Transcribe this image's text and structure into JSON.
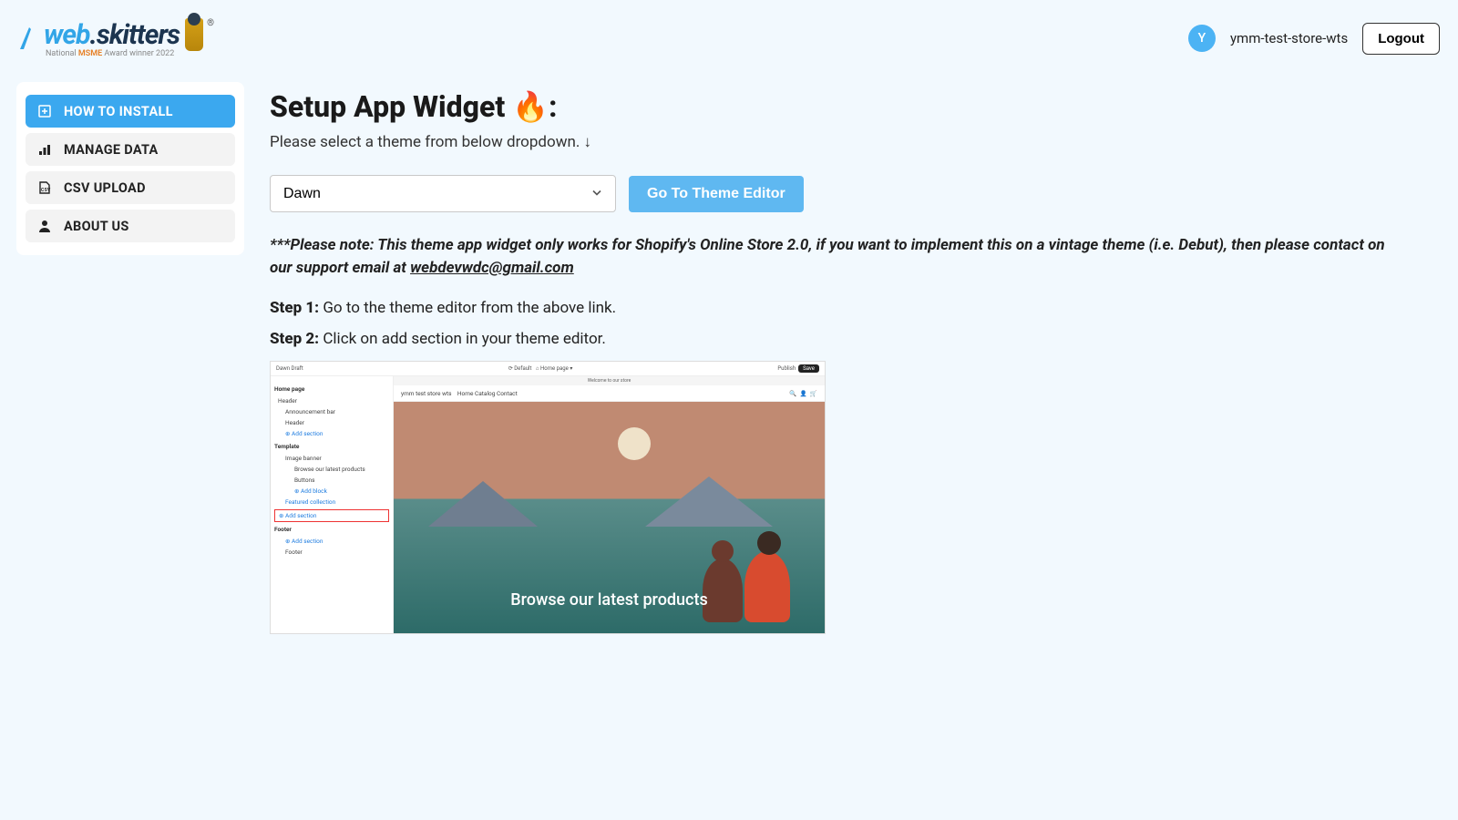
{
  "header": {
    "logo_primary": "web",
    "logo_secondary": "skitters",
    "logo_tagline_pre": "National ",
    "logo_tagline_em": "MSME",
    "logo_tagline_post": " Award winner 2022",
    "avatar_initial": "Y",
    "store_name": "ymm-test-store-wts",
    "logout": "Logout"
  },
  "sidebar": {
    "items": [
      {
        "label": "HOW TO INSTALL",
        "icon": "install"
      },
      {
        "label": "MANAGE DATA",
        "icon": "data"
      },
      {
        "label": "CSV UPLOAD",
        "icon": "csv"
      },
      {
        "label": "ABOUT US",
        "icon": "about"
      }
    ]
  },
  "main": {
    "title": "Setup App Widget 🔥:",
    "subtitle": "Please select a theme from below dropdown. ↓",
    "theme_selected": "Dawn",
    "go_button": "Go To Theme Editor",
    "note_prefix": "***Please note: This theme app widget only works for Shopify's Online Store 2.0, if you want to implement this on a vintage theme (i.e. Debut), then please contact on our support email at ",
    "note_email": "webdevwdc@gmail.com",
    "step1_label": "Step 1:",
    "step1_text": " Go to the theme editor from the above link.",
    "step2_label": "Step 2:",
    "step2_text": " Click on add section in your theme editor."
  },
  "shot": {
    "topbar_left": "Dawn   Draft",
    "topbar_mid1": "Default",
    "topbar_mid2": "Home page",
    "topbar_publish": "Publish",
    "topbar_save": "Save",
    "announce": "Welcome to our store",
    "store": "ymm test store wts",
    "nav": "Home    Catalog    Contact",
    "side_homepage": "Home page",
    "side_header": "Header",
    "side_announcement": "Announcement bar",
    "side_header2": "Header",
    "side_add1": "⊕ Add section",
    "side_template": "Template",
    "side_banner": "Image banner",
    "side_browse": "Browse our latest products",
    "side_buttons": "Buttons",
    "side_addblock": "⊕ Add block",
    "side_featured": "Featured collection",
    "side_add2": "⊕ Add section",
    "side_footer": "Footer",
    "side_add3": "⊕ Add section",
    "side_footer2": "Footer",
    "hero_text": "Browse our latest products"
  }
}
